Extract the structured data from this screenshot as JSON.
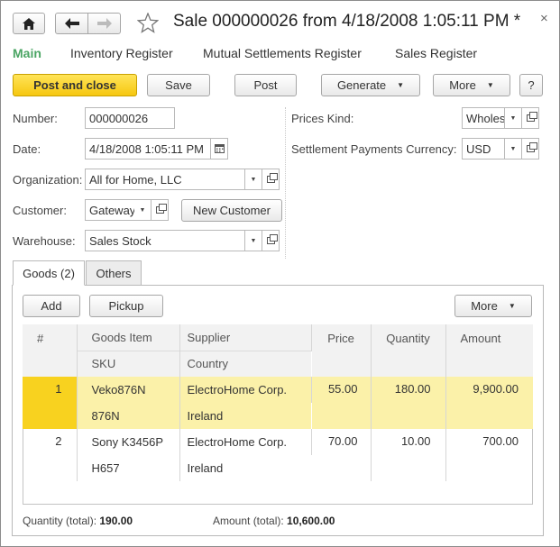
{
  "window": {
    "title": "Sale 000000026 from 4/18/2008 1:05:11 PM *",
    "close_glyph": "×"
  },
  "nav": {
    "links": [
      {
        "label": "Main"
      },
      {
        "label": "Inventory Register"
      },
      {
        "label": "Mutual Settlements Register"
      },
      {
        "label": "Sales Register"
      }
    ]
  },
  "toolbar": {
    "post_close": "Post and close",
    "save": "Save",
    "post": "Post",
    "generate": "Generate",
    "more": "More",
    "help": "?"
  },
  "form": {
    "number_label": "Number:",
    "number_value": "000000026",
    "date_label": "Date:",
    "date_value": "4/18/2008  1:05:11 PM",
    "organization_label": "Organization:",
    "organization_value": "All for Home, LLC",
    "customer_label": "Customer:",
    "customer_value": "Gateway",
    "new_customer": "New Customer",
    "warehouse_label": "Warehouse:",
    "warehouse_value": "Sales Stock",
    "prices_kind_label": "Prices Kind:",
    "prices_kind_value": "Wholesale",
    "currency_label": "Settlement Payments Currency:",
    "currency_value": "USD"
  },
  "tabs": [
    {
      "label": "Goods (2)"
    },
    {
      "label": "Others"
    }
  ],
  "goods": {
    "add": "Add",
    "pickup": "Pickup",
    "more": "More",
    "columns": {
      "num": "#",
      "goods_item": "Goods Item",
      "sku": "SKU",
      "supplier": "Supplier",
      "country": "Country",
      "price": "Price",
      "quantity": "Quantity",
      "amount": "Amount"
    },
    "rows": [
      {
        "num": "1",
        "goods_item": "Veko876N",
        "sku": "876N",
        "supplier": "ElectroHome Corp.",
        "country": "Ireland",
        "price": "55.00",
        "quantity": "180.00",
        "amount": "9,900.00"
      },
      {
        "num": "2",
        "goods_item": "Sony K3456P",
        "sku": "H657",
        "supplier": "ElectroHome Corp.",
        "country": "Ireland",
        "price": "70.00",
        "quantity": "10.00",
        "amount": "700.00"
      }
    ]
  },
  "totals": {
    "quantity_label": "Quantity (total):",
    "quantity_value": "190.00",
    "amount_label": "Amount (total):",
    "amount_value": "10,600.00"
  },
  "colors": {
    "accent_green": "#4ba564",
    "primary_button": "#f6c710",
    "selected_row": "#fbf1a9",
    "current_cell": "#f8d21f"
  }
}
